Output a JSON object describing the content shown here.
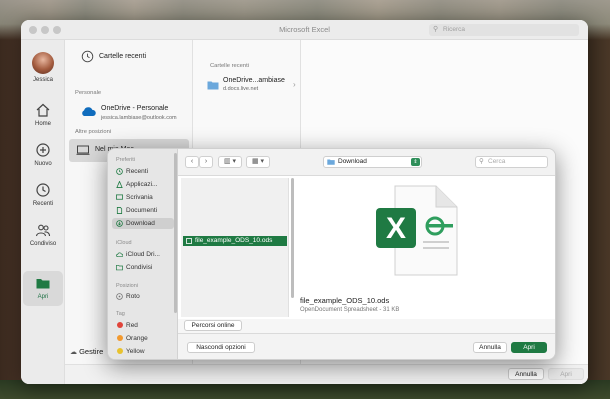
{
  "window": {
    "title": "Microsoft Excel",
    "search_placeholder": "Ricerca"
  },
  "rail": {
    "user_name": "Jessica",
    "items": [
      {
        "label": "Home",
        "icon": "home-icon"
      },
      {
        "label": "Nuovo",
        "icon": "plus-circle-icon"
      },
      {
        "label": "Recenti",
        "icon": "clock-icon"
      },
      {
        "label": "Condiviso",
        "icon": "people-icon"
      },
      {
        "label": "Apri",
        "icon": "folder-icon"
      }
    ]
  },
  "locations": {
    "recent_folders": "Cartelle recenti",
    "personal_header": "Personale",
    "onedrive_title": "OneDrive - Personale",
    "onedrive_email": "jessica.lambiase@outlook.com",
    "other_header": "Altre posizioni",
    "on_my_mac": "Nel mio Mac",
    "manage": "Gestire"
  },
  "recent_folders": {
    "header": "Cartelle recenti",
    "item_name": "OneDrive...ambiase",
    "item_sub": "d.docs.live.net"
  },
  "bottom_bar": {
    "cancel": "Annulla",
    "open": "Apri"
  },
  "dialog": {
    "sidebar": {
      "favorites_header": "Preferiti",
      "favorites": [
        "Recenti",
        "Applicazi...",
        "Scrivania",
        "Documenti",
        "Download"
      ],
      "icloud_header": "iCloud",
      "icloud": [
        "iCloud Dri...",
        "Condivisi"
      ],
      "locations_header": "Posizioni",
      "locations": [
        "Roto"
      ],
      "tags_header": "Tag",
      "tags": [
        {
          "name": "Red",
          "color": "#e0443a"
        },
        {
          "name": "Orange",
          "color": "#f2992e"
        },
        {
          "name": "Yellow",
          "color": "#e8c22e"
        }
      ]
    },
    "toolbar": {
      "back": "‹",
      "forward": "›",
      "view_columns": "▥ ▾",
      "view_grid": "▦ ▾",
      "location": "Download",
      "search_placeholder": "Cerca"
    },
    "selected_file": "file_example_ODS_10.ods",
    "preview": {
      "name": "file_example_ODS_10.ods",
      "info": "OpenDocument Spreadsheet - 31 KB"
    },
    "online_locations": "Percorsi online",
    "options_button": "Nascondi opzioni",
    "cancel": "Annulla",
    "open": "Apri"
  },
  "colors": {
    "excel_green": "#1f7a43",
    "accent": "#2f8f5a"
  }
}
